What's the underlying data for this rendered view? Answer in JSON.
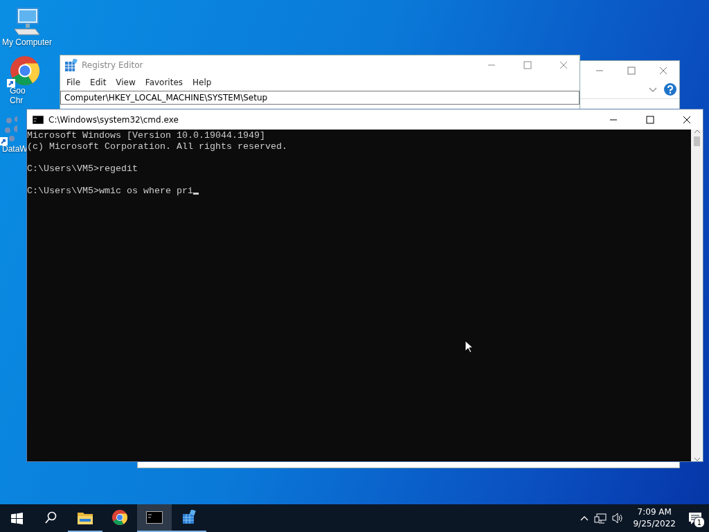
{
  "desktop_icons": [
    {
      "kind": "computer",
      "lines": [
        "My Computer"
      ],
      "shortcut": false
    },
    {
      "kind": "chrome",
      "lines": [
        "Goo",
        "Chr"
      ],
      "shortcut": true
    },
    {
      "kind": "dots",
      "lines": [
        "DataW"
      ],
      "shortcut": true
    }
  ],
  "registry_editor": {
    "title": "Registry Editor",
    "menu": [
      "File",
      "Edit",
      "View",
      "Favorites",
      "Help"
    ],
    "address": "Computer\\HKEY_LOCAL_MACHINE\\SYSTEM\\Setup"
  },
  "console": {
    "title": "C:\\Windows\\system32\\cmd.exe",
    "blocks": [
      [
        "Microsoft Windows [Version 10.0.19044.1949]",
        "(c) Microsoft Corporation. All rights reserved."
      ],
      [
        "C:\\Users\\VM5>regedit"
      ],
      [
        "C:\\Users\\VM5>wmic os where pri"
      ]
    ],
    "cursor": true
  },
  "taskbar": {
    "apps": [
      {
        "kind": "search",
        "selected": false,
        "running": false
      },
      {
        "kind": "folder",
        "selected": false,
        "running": true
      },
      {
        "kind": "chrome",
        "selected": false,
        "running": false
      },
      {
        "kind": "console",
        "selected": true,
        "running": true
      },
      {
        "kind": "registry",
        "selected": false,
        "running": true
      }
    ],
    "time": "7:09 AM",
    "date": "9/25/2022",
    "notifications": "1"
  }
}
